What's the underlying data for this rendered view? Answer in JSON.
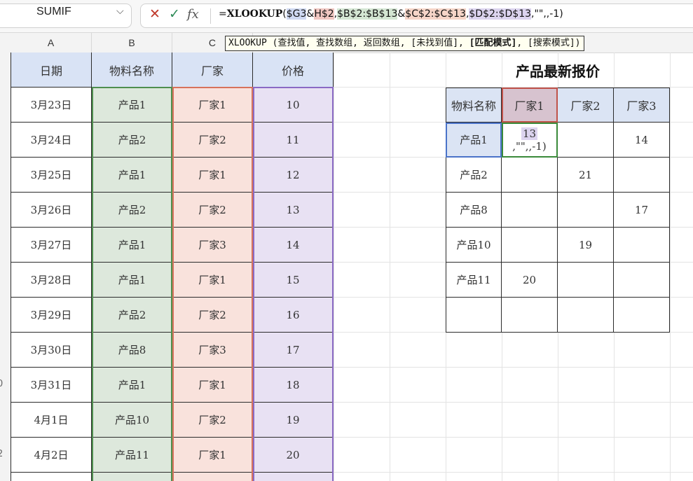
{
  "name_box": {
    "value": "SUMIF"
  },
  "formula_bar": {
    "cancel_label": "✕",
    "enter_label": "✓",
    "fx_label": "fx",
    "parts": [
      "=",
      "XLOOKUP",
      "(",
      "$G3",
      "&",
      "H$2",
      ",",
      "$B$2:$B$13",
      "&",
      "$C$2:$C$13",
      ",",
      "$D$2:$D$13",
      ",\"\",,-1)"
    ]
  },
  "tooltip": {
    "pre": "XLOOKUP (查找值, 查找数组, 返回数组, [未找到值], ",
    "current": "[匹配模式]",
    "post": ", [搜索模式])"
  },
  "columns": [
    "A",
    "B",
    "C"
  ],
  "row_numbers": [
    "0",
    "2"
  ],
  "left_table": {
    "headers": [
      "日期",
      "物料名称",
      "厂家",
      "价格"
    ],
    "rows": [
      [
        "3月23日",
        "产品1",
        "厂家1",
        "10"
      ],
      [
        "3月24日",
        "产品2",
        "厂家2",
        "11"
      ],
      [
        "3月25日",
        "产品1",
        "厂家1",
        "12"
      ],
      [
        "3月26日",
        "产品2",
        "厂家2",
        "13"
      ],
      [
        "3月27日",
        "产品1",
        "厂家3",
        "14"
      ],
      [
        "3月28日",
        "产品1",
        "厂家1",
        "15"
      ],
      [
        "3月29日",
        "产品2",
        "厂家2",
        "16"
      ],
      [
        "3月30日",
        "产品8",
        "厂家3",
        "17"
      ],
      [
        "3月31日",
        "产品1",
        "厂家1",
        "18"
      ],
      [
        "4月1日",
        "产品10",
        "厂家2",
        "19"
      ],
      [
        "4月2日",
        "产品11",
        "厂家1",
        "20"
      ]
    ]
  },
  "right_table": {
    "title": "产品最新报价",
    "headers": [
      "物料名称",
      "厂家1",
      "厂家2",
      "厂家3"
    ],
    "editing_cell": {
      "line1": "13",
      "line2": ",\"\",,-1)"
    },
    "rows": [
      [
        "产品1",
        "",
        "",
        "14"
      ],
      [
        "产品2",
        "",
        "21",
        ""
      ],
      [
        "产品8",
        "",
        "",
        "17"
      ],
      [
        "产品10",
        "",
        "19",
        ""
      ],
      [
        "产品11",
        "20",
        "",
        ""
      ],
      [
        "",
        "",
        "",
        ""
      ]
    ]
  },
  "colors": {
    "header_blue": "#d9e3f5",
    "col_green": "#dde8dc",
    "col_salmon": "#f9e2dc",
    "col_purple": "#e8e1f3",
    "edit_border": "#3a8a3a"
  }
}
